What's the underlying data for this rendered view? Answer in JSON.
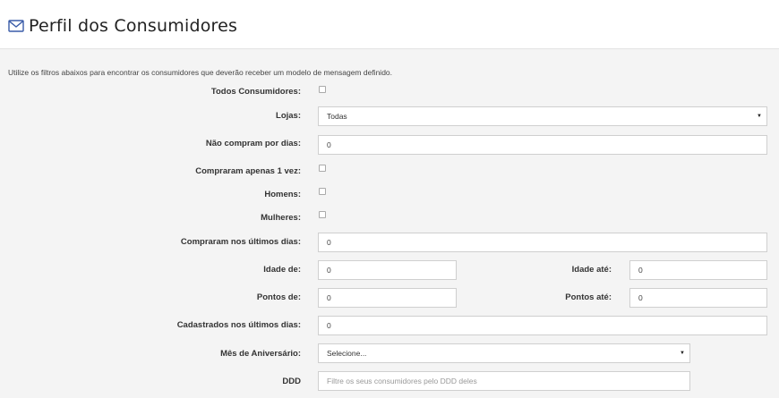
{
  "header": {
    "title": "Perfil dos Consumidores",
    "icon": "envelope-icon",
    "accent": "#3a5ca8"
  },
  "intro": "Utilize os filtros abaixos para encontrar os consumidores que deverão receber um modelo de mensagem definido.",
  "form": {
    "todos_label": "Todos Consumidores:",
    "lojas_label": "Lojas:",
    "lojas_value": "Todas",
    "nao_compram_label": "Não compram por dias:",
    "nao_compram_value": "0",
    "compraram_1_label": "Compraram apenas 1 vez:",
    "homens_label": "Homens:",
    "mulheres_label": "Mulheres:",
    "compraram_ultimos_label": "Compraram nos últimos dias:",
    "compraram_ultimos_value": "0",
    "idade_de_label": "Idade de:",
    "idade_de_value": "0",
    "idade_ate_label": "Idade até:",
    "idade_ate_value": "0",
    "pontos_de_label": "Pontos de:",
    "pontos_de_value": "0",
    "pontos_ate_label": "Pontos até:",
    "pontos_ate_value": "0",
    "cadastrados_label": "Cadastrados nos últimos dias:",
    "cadastrados_value": "0",
    "mes_label": "Mês de Aniversário:",
    "mes_value": "Selecione...",
    "ddd_label": "DDD",
    "ddd_placeholder": "Filtre os seus consumidores pelo DDD deles"
  }
}
